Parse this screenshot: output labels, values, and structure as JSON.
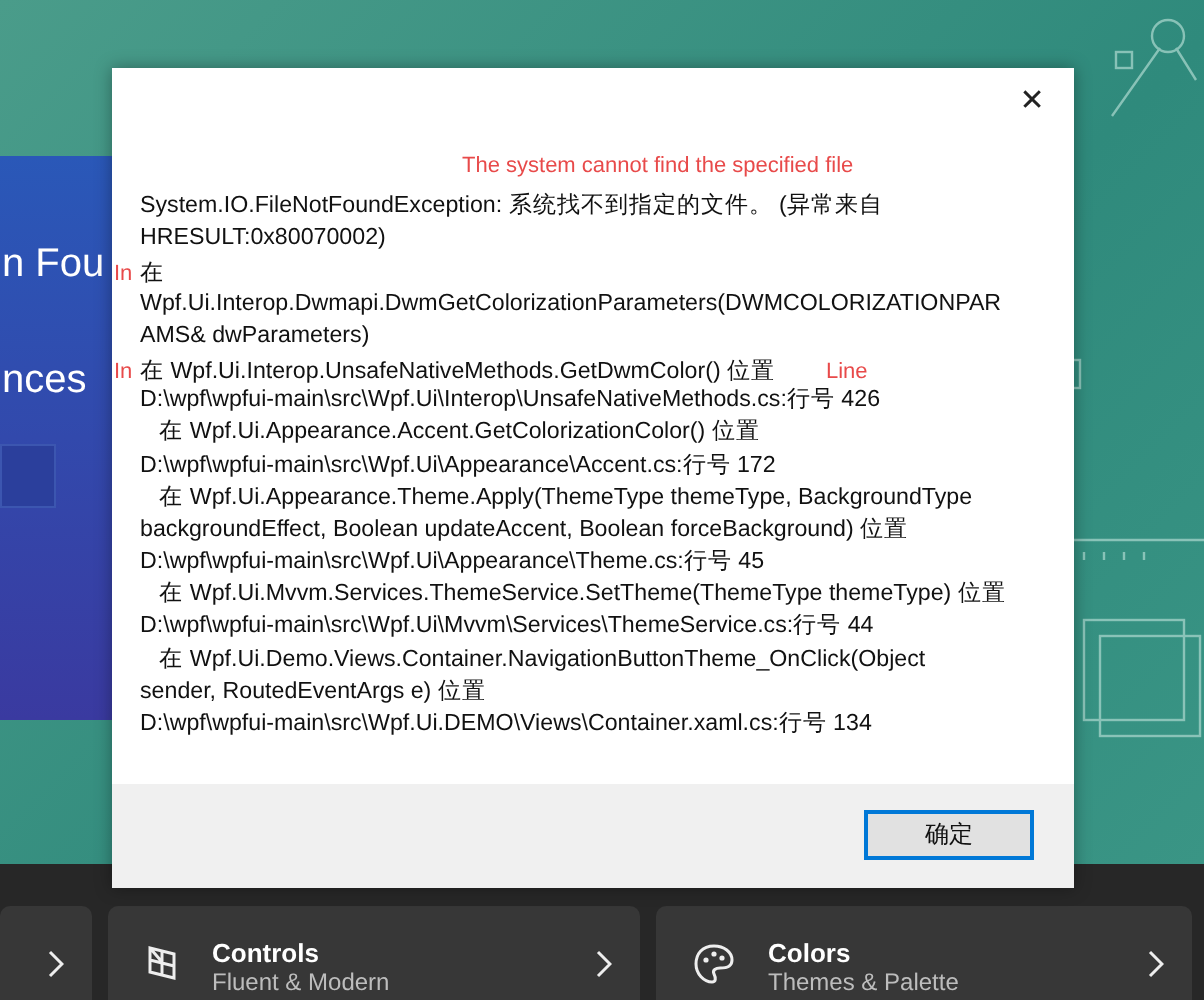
{
  "hero": {
    "banner_lines": [
      "n Fou",
      "nces"
    ]
  },
  "dialog": {
    "close": "✕",
    "annotation": "The system cannot find the specified file",
    "line_annotation": "Line",
    "lines": [
      {
        "text": "System.IO.FileNotFoundException: 系统找不到指定的文件。 (异常来自"
      },
      {
        "text": "HRESULT:0x80070002)"
      },
      {
        "marker": "In",
        "text": "在"
      },
      {
        "text": "Wpf.Ui.Interop.Dwmapi.DwmGetColorizationParameters(DWMCOLORIZATIONPAR"
      },
      {
        "text": "AMS& dwParameters)"
      },
      {
        "marker": "In",
        "text": "在 Wpf.Ui.Interop.UnsafeNativeMethods.GetDwmColor() 位置"
      },
      {
        "text": "D:\\wpf\\wpfui-main\\src\\Wpf.Ui\\Interop\\UnsafeNativeMethods.cs:行号 426"
      },
      {
        "text": "   在 Wpf.Ui.Appearance.Accent.GetColorizationColor() 位置"
      },
      {
        "text": "D:\\wpf\\wpfui-main\\src\\Wpf.Ui\\Appearance\\Accent.cs:行号 172"
      },
      {
        "text": "   在 Wpf.Ui.Appearance.Theme.Apply(ThemeType themeType, BackgroundType"
      },
      {
        "text": "backgroundEffect, Boolean updateAccent, Boolean forceBackground) 位置"
      },
      {
        "text": "D:\\wpf\\wpfui-main\\src\\Wpf.Ui\\Appearance\\Theme.cs:行号 45"
      },
      {
        "text": "   在 Wpf.Ui.Mvvm.Services.ThemeService.SetTheme(ThemeType themeType) 位置"
      },
      {
        "text": "D:\\wpf\\wpfui-main\\src\\Wpf.Ui\\Mvvm\\Services\\ThemeService.cs:行号 44"
      },
      {
        "text": "   在 Wpf.Ui.Demo.Views.Container.NavigationButtonTheme_OnClick(Object"
      },
      {
        "text": "sender, RoutedEventArgs e) 位置"
      },
      {
        "text": "D:\\wpf\\wpfui-main\\src\\Wpf.Ui.DEMO\\Views\\Container.xaml.cs:行号 134"
      }
    ],
    "ok_button": "确定"
  },
  "cards": [
    {
      "kind": "partial"
    },
    {
      "kind": "controls",
      "title": "Controls",
      "subtitle": "Fluent & Modern"
    },
    {
      "kind": "colors",
      "title": "Colors",
      "subtitle": "Themes & Palette"
    }
  ]
}
